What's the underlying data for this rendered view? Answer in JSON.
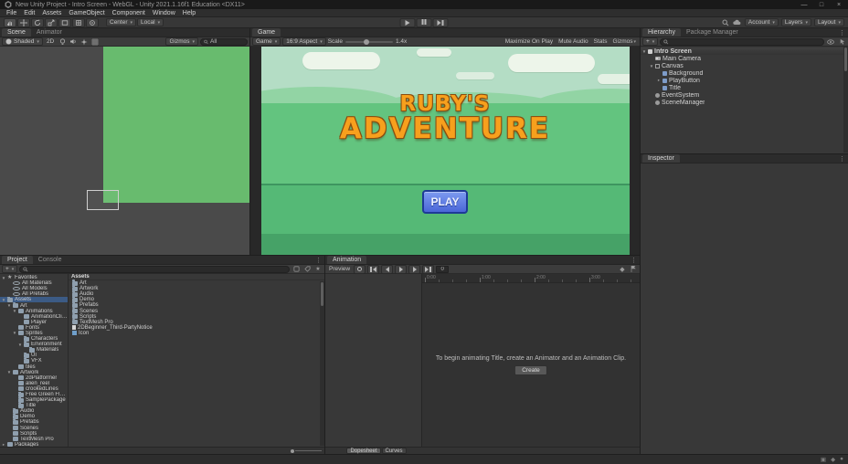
{
  "window": {
    "title": "New Unity Project - Intro Screen - WebGL - Unity 2021.1.16f1 Education <DX11>",
    "minimize": "—",
    "maximize": "□",
    "close": "×"
  },
  "menu": {
    "items": [
      "File",
      "Edit",
      "Assets",
      "GameObject",
      "Component",
      "Window",
      "Help"
    ]
  },
  "toolbar": {
    "pivot_label": "Center",
    "space_label": "Local",
    "account_label": "Account",
    "layers_label": "Layers",
    "layout_label": "Layout"
  },
  "scene": {
    "tabs": [
      "Scene",
      "Animator"
    ],
    "toolbar": {
      "shading": "Shaded",
      "mode_2d": "2D",
      "gizmos_label": "Gizmos",
      "search_value": "All"
    }
  },
  "game": {
    "tab": "Game",
    "toolbar": {
      "display": "Game",
      "aspect": "16:9 Aspect",
      "scale_label": "Scale",
      "scale_value": "1.4x",
      "maximize_label": "Maximize On Play",
      "mute_label": "Mute Audio",
      "stats_label": "Stats",
      "gizmos_label": "Gizmos"
    },
    "screen": {
      "title_line1": "RUBY'S",
      "title_line2": "ADVENTURE",
      "play_label": "PLAY"
    }
  },
  "hierarchy": {
    "tabs": [
      "Hierarchy",
      "Package Manager"
    ],
    "add_label": "+",
    "items": [
      {
        "label": "Intro Screen",
        "depth": 0,
        "icon": "scene",
        "exp": "▼"
      },
      {
        "label": "Main Camera",
        "depth": 1,
        "icon": "camera"
      },
      {
        "label": "Canvas",
        "depth": 1,
        "icon": "canvas",
        "exp": "▼"
      },
      {
        "label": "Background",
        "depth": 2,
        "icon": "ui"
      },
      {
        "label": "PlayButton",
        "depth": 2,
        "icon": "ui",
        "exp": "▸"
      },
      {
        "label": "Title",
        "depth": 2,
        "icon": "ui"
      },
      {
        "label": "EventSystem",
        "depth": 1,
        "icon": "go"
      },
      {
        "label": "SceneManager",
        "depth": 1,
        "icon": "go"
      }
    ]
  },
  "inspector": {
    "tab": "Inspector"
  },
  "project": {
    "tabs": [
      "Project",
      "Console"
    ],
    "add_label": "+",
    "assets_header": "Assets",
    "tree": [
      {
        "label": "Favorites",
        "depth": 0,
        "icon": "star",
        "exp": "▼"
      },
      {
        "label": "All Materials",
        "depth": 1,
        "icon": "search"
      },
      {
        "label": "All Models",
        "depth": 1,
        "icon": "search"
      },
      {
        "label": "All Prefabs",
        "depth": 1,
        "icon": "search"
      },
      {
        "label": "Assets",
        "depth": 0,
        "icon": "folder",
        "exp": "▼",
        "selected": true
      },
      {
        "label": "Art",
        "depth": 1,
        "icon": "folder",
        "exp": "▼"
      },
      {
        "label": "Animations",
        "depth": 2,
        "icon": "folder",
        "exp": "▼"
      },
      {
        "label": "AnimationClips",
        "depth": 3,
        "icon": "folder"
      },
      {
        "label": "Player",
        "depth": 3,
        "icon": "folder"
      },
      {
        "label": "Fonts",
        "depth": 2,
        "icon": "folder"
      },
      {
        "label": "Sprites",
        "depth": 2,
        "icon": "folder",
        "exp": "▼"
      },
      {
        "label": "Characters",
        "depth": 3,
        "icon": "folder"
      },
      {
        "label": "Environment",
        "depth": 3,
        "icon": "folder",
        "exp": "▼"
      },
      {
        "label": "Materials",
        "depth": 4,
        "icon": "folder"
      },
      {
        "label": "UI",
        "depth": 3,
        "icon": "folder"
      },
      {
        "label": "VFX",
        "depth": 3,
        "icon": "folder"
      },
      {
        "label": "tiles",
        "depth": 2,
        "icon": "folder"
      },
      {
        "label": "Artwork",
        "depth": 1,
        "icon": "folder",
        "exp": "▼"
      },
      {
        "label": "2dPlatformer",
        "depth": 2,
        "icon": "folder"
      },
      {
        "label": "alien_reel",
        "depth": 2,
        "icon": "folder"
      },
      {
        "label": "crookedLines",
        "depth": 2,
        "icon": "folder"
      },
      {
        "label": "Free Green Flappy Stupi",
        "depth": 2,
        "icon": "folder"
      },
      {
        "label": "SamplePackage",
        "depth": 2,
        "icon": "folder"
      },
      {
        "label": "Title",
        "depth": 2,
        "icon": "folder"
      },
      {
        "label": "Audio",
        "depth": 1,
        "icon": "folder"
      },
      {
        "label": "Demo",
        "depth": 1,
        "icon": "folder"
      },
      {
        "label": "Prefabs",
        "depth": 1,
        "icon": "folder"
      },
      {
        "label": "Scenes",
        "depth": 1,
        "icon": "folder"
      },
      {
        "label": "Scripts",
        "depth": 1,
        "icon": "folder"
      },
      {
        "label": "TextMesh Pro",
        "depth": 1,
        "icon": "folder"
      },
      {
        "label": "Packages",
        "depth": 0,
        "icon": "folder",
        "exp": "▸"
      }
    ],
    "assets": [
      {
        "label": "Art",
        "icon": "folder"
      },
      {
        "label": "Artwork",
        "icon": "folder"
      },
      {
        "label": "Audio",
        "icon": "folder"
      },
      {
        "label": "Demo",
        "icon": "folder"
      },
      {
        "label": "Prefabs",
        "icon": "folder"
      },
      {
        "label": "Scenes",
        "icon": "folder"
      },
      {
        "label": "Scripts",
        "icon": "folder"
      },
      {
        "label": "TextMesh Pro",
        "icon": "folder"
      },
      {
        "label": "2DBeginner_Third-PartyNotice",
        "icon": "text"
      },
      {
        "label": "Icon",
        "icon": "file"
      }
    ]
  },
  "animation": {
    "tab": "Animation",
    "preview_label": "Preview",
    "frame_value": "0",
    "ruler_labels": [
      "0:00",
      "1:00",
      "2:00",
      "3:00"
    ],
    "message": "To begin animating Title, create an Animator and an Animation Clip.",
    "create_label": "Create",
    "dopesheet_label": "Dopesheet",
    "curves_label": "Curves"
  },
  "icons": {
    "dropdown_arrow": "▾",
    "overflow_menu": "⋮",
    "expander_expanded": "▼",
    "expander_collapsed": "▸",
    "keyframe": "◆"
  },
  "colors": {
    "selection_blue": "#3c5b85",
    "play_button_blue": "#5b7fdd",
    "title_orange": "#f7a01d",
    "sky_green": "#b4ddc5",
    "field_green": "#63c47f",
    "dark_green": "#46a267"
  }
}
